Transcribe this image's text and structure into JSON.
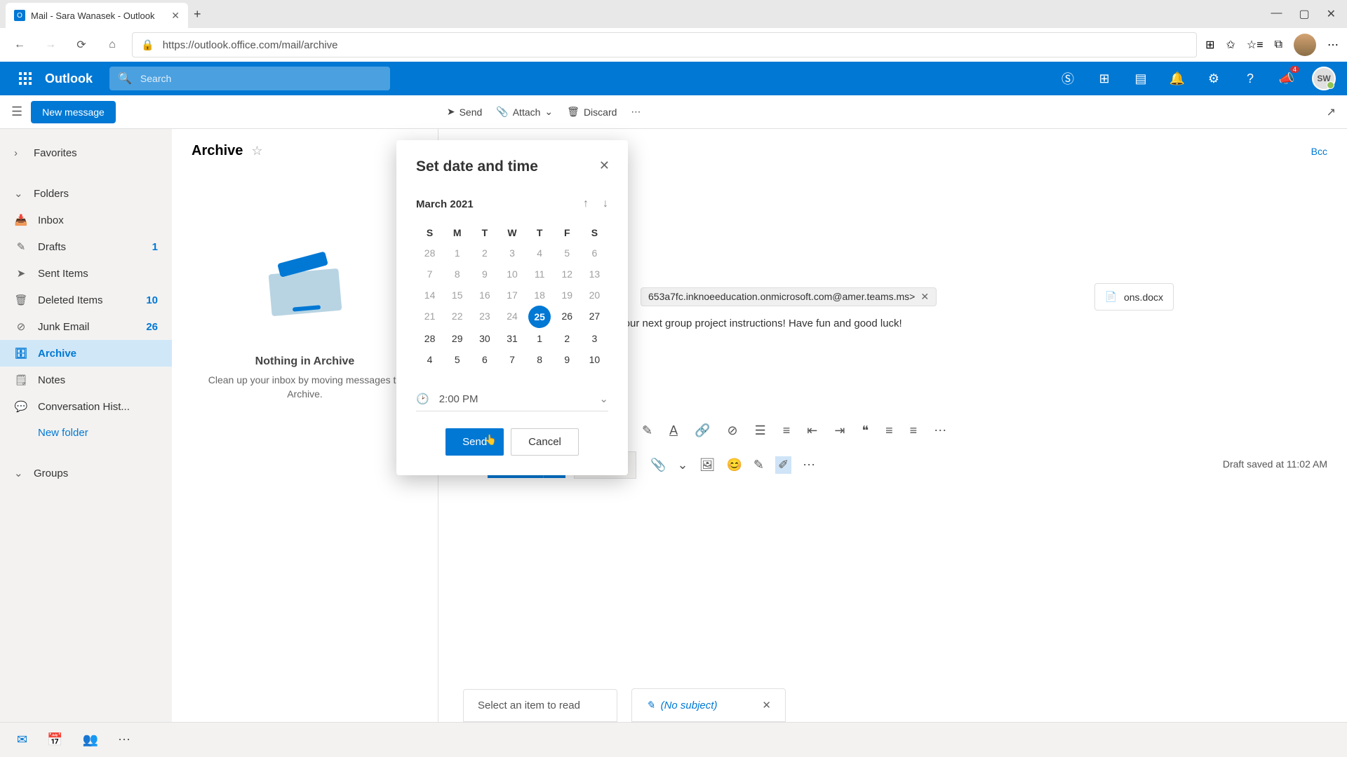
{
  "browser": {
    "tab_title": "Mail - Sara Wanasek - Outlook",
    "url": "https://outlook.office.com/mail/archive"
  },
  "app": {
    "brand": "Outlook",
    "search_placeholder": "Search",
    "avatar_initials": "SW",
    "notification_badge": "4"
  },
  "commands": {
    "new_message": "New message",
    "send": "Send",
    "attach": "Attach",
    "discard": "Discard"
  },
  "sidebar": {
    "favorites": "Favorites",
    "folders": "Folders",
    "items": [
      {
        "label": "Inbox",
        "count": ""
      },
      {
        "label": "Drafts",
        "count": "1"
      },
      {
        "label": "Sent Items",
        "count": ""
      },
      {
        "label": "Deleted Items",
        "count": "10"
      },
      {
        "label": "Junk Email",
        "count": "26"
      },
      {
        "label": "Archive",
        "count": ""
      },
      {
        "label": "Notes",
        "count": ""
      },
      {
        "label": "Conversation Hist...",
        "count": ""
      }
    ],
    "new_folder": "New folder",
    "groups": "Groups"
  },
  "list": {
    "title": "Archive",
    "empty_title": "Nothing in Archive",
    "empty_sub": "Clean up your inbox by moving messages to Archive."
  },
  "compose": {
    "bcc": "Bcc",
    "recipient": "653a7fc.inknoeeducation.onmicrosoft.com@amer.teams.ms>",
    "attachment": "ons.docx",
    "body_text": "r your next group project instructions! Have fun and good luck!",
    "send": "Send",
    "discard": "Discard",
    "draft_saved": "Draft saved at 11:02 AM"
  },
  "reading": {
    "prompt": "Select an item to read",
    "no_subject": "(No subject)"
  },
  "dialog": {
    "title": "Set date and time",
    "month_label": "March 2021",
    "dow": [
      "S",
      "M",
      "T",
      "W",
      "T",
      "F",
      "S"
    ],
    "weeks": [
      [
        {
          "n": "28",
          "m": false
        },
        {
          "n": "1",
          "m": false
        },
        {
          "n": "2",
          "m": false
        },
        {
          "n": "3",
          "m": false
        },
        {
          "n": "4",
          "m": false
        },
        {
          "n": "5",
          "m": false
        },
        {
          "n": "6",
          "m": false
        }
      ],
      [
        {
          "n": "7",
          "m": false
        },
        {
          "n": "8",
          "m": false
        },
        {
          "n": "9",
          "m": false
        },
        {
          "n": "10",
          "m": false
        },
        {
          "n": "11",
          "m": false
        },
        {
          "n": "12",
          "m": false
        },
        {
          "n": "13",
          "m": false
        }
      ],
      [
        {
          "n": "14",
          "m": false
        },
        {
          "n": "15",
          "m": false
        },
        {
          "n": "16",
          "m": false
        },
        {
          "n": "17",
          "m": false
        },
        {
          "n": "18",
          "m": false
        },
        {
          "n": "19",
          "m": false
        },
        {
          "n": "20",
          "m": false
        }
      ],
      [
        {
          "n": "21",
          "m": false
        },
        {
          "n": "22",
          "m": false
        },
        {
          "n": "23",
          "m": false
        },
        {
          "n": "24",
          "m": false
        },
        {
          "n": "25",
          "m": true,
          "sel": true
        },
        {
          "n": "26",
          "m": true
        },
        {
          "n": "27",
          "m": true
        }
      ],
      [
        {
          "n": "28",
          "m": true
        },
        {
          "n": "29",
          "m": true
        },
        {
          "n": "30",
          "m": true
        },
        {
          "n": "31",
          "m": true
        },
        {
          "n": "1",
          "m": true
        },
        {
          "n": "2",
          "m": true
        },
        {
          "n": "3",
          "m": true
        }
      ],
      [
        {
          "n": "4",
          "m": true
        },
        {
          "n": "5",
          "m": true
        },
        {
          "n": "6",
          "m": true
        },
        {
          "n": "7",
          "m": true
        },
        {
          "n": "8",
          "m": true
        },
        {
          "n": "9",
          "m": true
        },
        {
          "n": "10",
          "m": true
        }
      ]
    ],
    "time": "2:00 PM",
    "send": "Send",
    "cancel": "Cancel"
  }
}
